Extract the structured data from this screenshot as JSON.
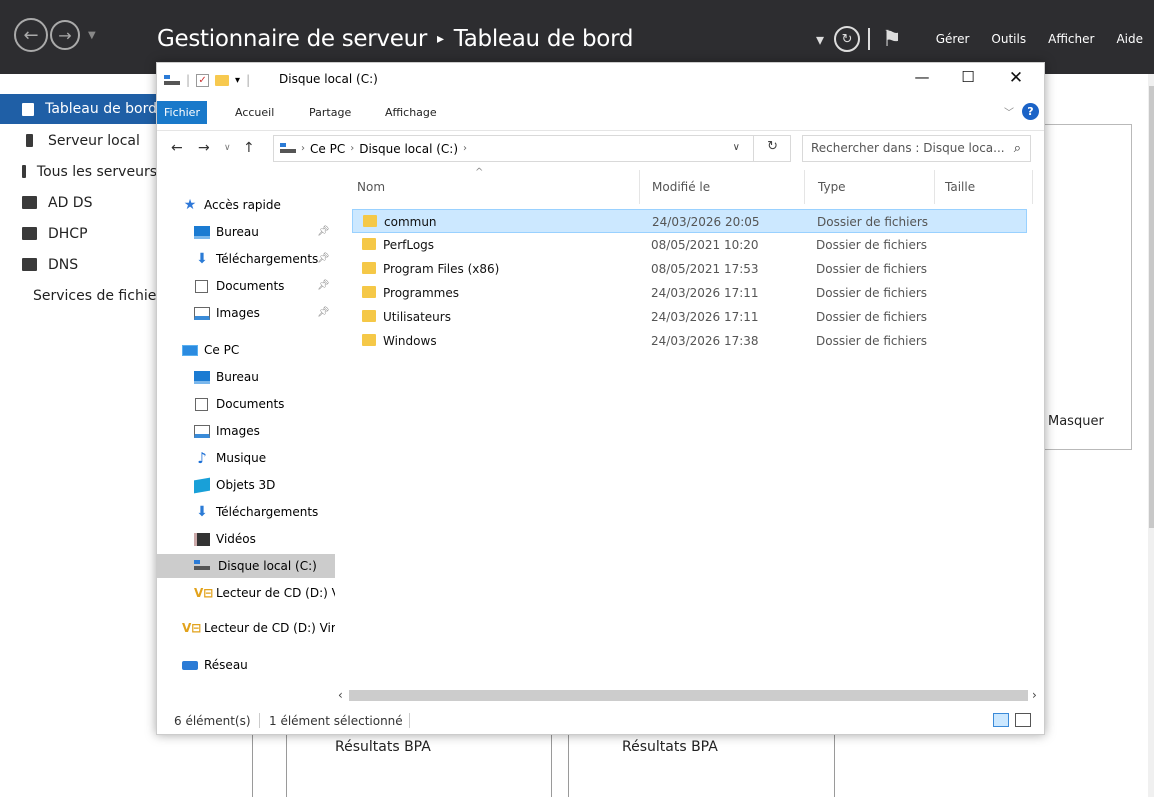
{
  "server_manager": {
    "title": "Gestionnaire de serveur",
    "title_sep": "▸",
    "title_page": "Tableau de bord",
    "menu": [
      "Gérer",
      "Outils",
      "Afficher",
      "Aide"
    ],
    "sidebar": [
      {
        "label": "Tableau de bord",
        "icon": "dashboard-icon",
        "active": true
      },
      {
        "label": "Serveur local",
        "icon": "server-icon"
      },
      {
        "label": "Tous les serveurs",
        "icon": "servers-icon"
      },
      {
        "label": "AD DS",
        "icon": "ad-ds-icon"
      },
      {
        "label": "DHCP",
        "icon": "dhcp-icon"
      },
      {
        "label": "DNS",
        "icon": "dns-icon"
      },
      {
        "label": "Services de fichiers",
        "icon": "file-services-icon"
      }
    ],
    "masquer": "Masquer",
    "bpa_1": "Résultats BPA",
    "bpa_2": "Résultats BPA"
  },
  "explorer": {
    "title": "Disque local (C:)",
    "ribbon_tabs": [
      "Fichier",
      "Accueil",
      "Partage",
      "Affichage"
    ],
    "address": {
      "crumbs": [
        "Ce PC",
        "Disque local (C:)"
      ]
    },
    "search_placeholder": "Rechercher dans : Disque loca...",
    "tree": [
      {
        "label": "Accès rapide",
        "icon": "star",
        "pinned": false
      },
      {
        "label": "Bureau",
        "icon": "desk",
        "pinned": true
      },
      {
        "label": "Téléchargements",
        "icon": "down",
        "pinned": true
      },
      {
        "label": "Documents",
        "icon": "doc",
        "pinned": true
      },
      {
        "label": "Images",
        "icon": "img",
        "pinned": true
      },
      {
        "label": "Ce PC",
        "icon": "pc",
        "pinned": false
      },
      {
        "label": "Bureau",
        "icon": "desk",
        "pinned": false
      },
      {
        "label": "Documents",
        "icon": "doc",
        "pinned": false
      },
      {
        "label": "Images",
        "icon": "img",
        "pinned": false
      },
      {
        "label": "Musique",
        "icon": "note",
        "pinned": false
      },
      {
        "label": "Objets 3D",
        "icon": "cube",
        "pinned": false
      },
      {
        "label": "Téléchargements",
        "icon": "down",
        "pinned": false
      },
      {
        "label": "Vidéos",
        "icon": "vid",
        "pinned": false
      },
      {
        "label": "Disque local (C:)",
        "icon": "drive",
        "pinned": false,
        "selected": true
      },
      {
        "label": "Lecteur de CD (D:) Vi",
        "icon": "cd",
        "pinned": false
      },
      {
        "label": "Lecteur de CD (D:) Vir",
        "icon": "cd",
        "pinned": false
      },
      {
        "label": "Réseau",
        "icon": "net",
        "pinned": false
      }
    ],
    "columns": {
      "name": "Nom",
      "modified": "Modifié le",
      "type": "Type",
      "size": "Taille"
    },
    "files": [
      {
        "name": "commun",
        "modified": "24/03/2026 20:05",
        "type": "Dossier de fichiers",
        "selected": true
      },
      {
        "name": "PerfLogs",
        "modified": "08/05/2021 10:20",
        "type": "Dossier de fichiers"
      },
      {
        "name": "Program Files (x86)",
        "modified": "08/05/2021 17:53",
        "type": "Dossier de fichiers"
      },
      {
        "name": "Programmes",
        "modified": "24/03/2026 17:11",
        "type": "Dossier de fichiers"
      },
      {
        "name": "Utilisateurs",
        "modified": "24/03/2026 17:11",
        "type": "Dossier de fichiers"
      },
      {
        "name": "Windows",
        "modified": "24/03/2026 17:38",
        "type": "Dossier de fichiers"
      }
    ],
    "status": {
      "count": "6 élément(s)",
      "selection": "1 élément sélectionné"
    }
  }
}
